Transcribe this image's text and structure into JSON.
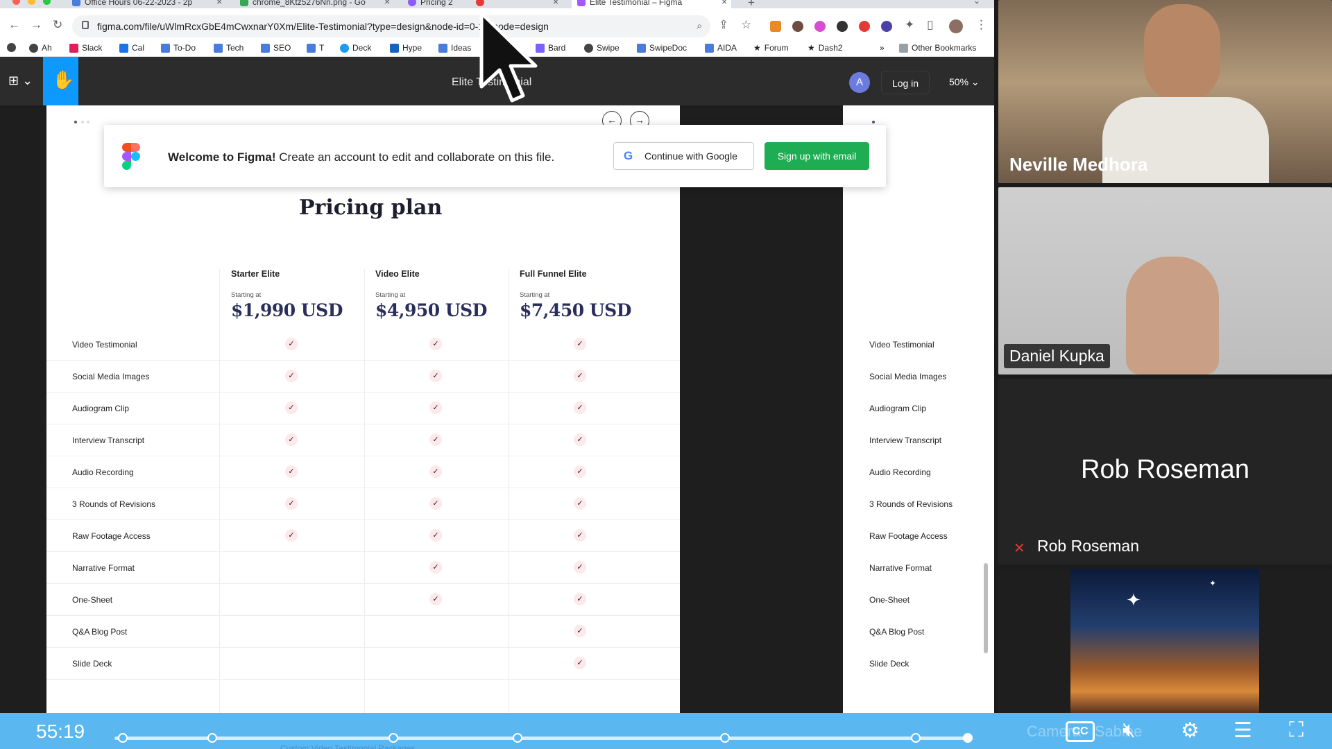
{
  "browser": {
    "tabs": [
      {
        "title": "Office Hours 06-22-2023 - 2p"
      },
      {
        "title": "chrome_8Ktz5276Nn.png - Go"
      },
      {
        "title": "Pricing 2"
      },
      {
        "title": ""
      },
      {
        "title": "Elite Testimonial – Figma"
      }
    ],
    "url": "figma.com/file/uWlmRcxGbE4mCwxnarY0Xm/Elite-Testimonial?type=design&node-id=0-1&mode=design",
    "bookmarks": [
      "Ah",
      "Slack",
      "Cal",
      "To-Do",
      "Tech",
      "SEO",
      "T",
      "Deck",
      "Hype",
      "Ideas",
      "Bard",
      "Swipe",
      "SwipeDoc",
      "AIDA",
      "Forum",
      "Dash2"
    ],
    "overflow": "»",
    "other_bookmarks": "Other Bookmarks"
  },
  "figma": {
    "file_title": "Elite Testimonial",
    "avatar_initial": "A",
    "login_label": "Log in",
    "zoom": "50%"
  },
  "banner": {
    "welcome_bold": "Welcome to Figma!",
    "welcome_text": " Create an account to edit and collaborate on this file.",
    "google_label": "Continue with Google",
    "email_label": "Sign up with email"
  },
  "pricing": {
    "title": "Pricing plan",
    "starting_at": "Starting at",
    "plans": [
      {
        "name": "Starter Elite",
        "price": "$1,990 USD"
      },
      {
        "name": "Video Elite",
        "price": "$4,950 USD"
      },
      {
        "name": "Full Funnel Elite",
        "price": "$7,450 USD"
      }
    ],
    "features": [
      {
        "label": "Video Testimonial",
        "included": [
          true,
          true,
          true
        ]
      },
      {
        "label": "Social Media Images",
        "included": [
          true,
          true,
          true
        ]
      },
      {
        "label": "Audiogram Clip",
        "included": [
          true,
          true,
          true
        ]
      },
      {
        "label": "Interview Transcript",
        "included": [
          true,
          true,
          true
        ]
      },
      {
        "label": "Audio Recording",
        "included": [
          true,
          true,
          true
        ]
      },
      {
        "label": "3 Rounds of Revisions",
        "included": [
          true,
          true,
          true
        ]
      },
      {
        "label": "Raw Footage Access",
        "included": [
          true,
          true,
          true
        ]
      },
      {
        "label": "Narrative Format",
        "included": [
          false,
          true,
          true
        ]
      },
      {
        "label": "One-Sheet",
        "included": [
          false,
          true,
          true
        ]
      },
      {
        "label": "Q&A Blog Post",
        "included": [
          false,
          false,
          true
        ]
      },
      {
        "label": "Slide Deck",
        "included": [
          false,
          false,
          true
        ]
      }
    ]
  },
  "participants": {
    "p1": "Neville Medhora",
    "p2": "Daniel Kupka",
    "p3": "Rob Roseman"
  },
  "player": {
    "time": "55:19",
    "cc_label": "CC",
    "ghost_caption": "Custom Video Testimonial Packages",
    "ghost_label": "Camera · Sabine"
  },
  "colors": {
    "accent_blue": "#0d99ff",
    "green_button": "#1fad53",
    "price_navy": "#2a2e5c",
    "check_pink": "#fde8ec",
    "player_blue": "#5bb7f0"
  }
}
